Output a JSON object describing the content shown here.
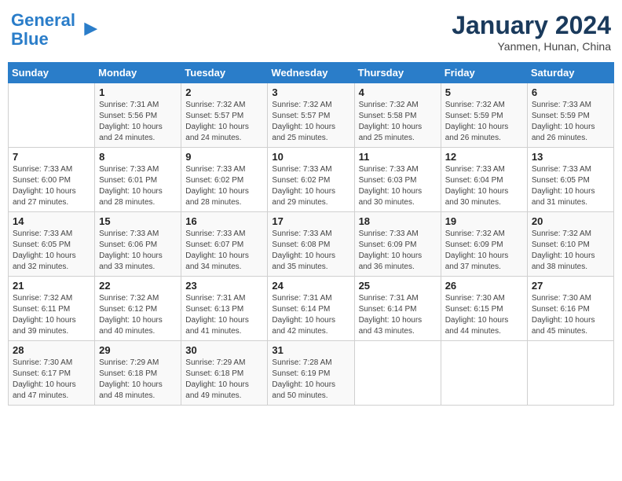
{
  "header": {
    "logo_line1": "General",
    "logo_line2": "Blue",
    "month": "January 2024",
    "location": "Yanmen, Hunan, China"
  },
  "weekdays": [
    "Sunday",
    "Monday",
    "Tuesday",
    "Wednesday",
    "Thursday",
    "Friday",
    "Saturday"
  ],
  "weeks": [
    [
      {
        "day": "",
        "info": ""
      },
      {
        "day": "1",
        "info": "Sunrise: 7:31 AM\nSunset: 5:56 PM\nDaylight: 10 hours\nand 24 minutes."
      },
      {
        "day": "2",
        "info": "Sunrise: 7:32 AM\nSunset: 5:57 PM\nDaylight: 10 hours\nand 24 minutes."
      },
      {
        "day": "3",
        "info": "Sunrise: 7:32 AM\nSunset: 5:57 PM\nDaylight: 10 hours\nand 25 minutes."
      },
      {
        "day": "4",
        "info": "Sunrise: 7:32 AM\nSunset: 5:58 PM\nDaylight: 10 hours\nand 25 minutes."
      },
      {
        "day": "5",
        "info": "Sunrise: 7:32 AM\nSunset: 5:59 PM\nDaylight: 10 hours\nand 26 minutes."
      },
      {
        "day": "6",
        "info": "Sunrise: 7:33 AM\nSunset: 5:59 PM\nDaylight: 10 hours\nand 26 minutes."
      }
    ],
    [
      {
        "day": "7",
        "info": "Sunrise: 7:33 AM\nSunset: 6:00 PM\nDaylight: 10 hours\nand 27 minutes."
      },
      {
        "day": "8",
        "info": "Sunrise: 7:33 AM\nSunset: 6:01 PM\nDaylight: 10 hours\nand 28 minutes."
      },
      {
        "day": "9",
        "info": "Sunrise: 7:33 AM\nSunset: 6:02 PM\nDaylight: 10 hours\nand 28 minutes."
      },
      {
        "day": "10",
        "info": "Sunrise: 7:33 AM\nSunset: 6:02 PM\nDaylight: 10 hours\nand 29 minutes."
      },
      {
        "day": "11",
        "info": "Sunrise: 7:33 AM\nSunset: 6:03 PM\nDaylight: 10 hours\nand 30 minutes."
      },
      {
        "day": "12",
        "info": "Sunrise: 7:33 AM\nSunset: 6:04 PM\nDaylight: 10 hours\nand 30 minutes."
      },
      {
        "day": "13",
        "info": "Sunrise: 7:33 AM\nSunset: 6:05 PM\nDaylight: 10 hours\nand 31 minutes."
      }
    ],
    [
      {
        "day": "14",
        "info": "Sunrise: 7:33 AM\nSunset: 6:05 PM\nDaylight: 10 hours\nand 32 minutes."
      },
      {
        "day": "15",
        "info": "Sunrise: 7:33 AM\nSunset: 6:06 PM\nDaylight: 10 hours\nand 33 minutes."
      },
      {
        "day": "16",
        "info": "Sunrise: 7:33 AM\nSunset: 6:07 PM\nDaylight: 10 hours\nand 34 minutes."
      },
      {
        "day": "17",
        "info": "Sunrise: 7:33 AM\nSunset: 6:08 PM\nDaylight: 10 hours\nand 35 minutes."
      },
      {
        "day": "18",
        "info": "Sunrise: 7:33 AM\nSunset: 6:09 PM\nDaylight: 10 hours\nand 36 minutes."
      },
      {
        "day": "19",
        "info": "Sunrise: 7:32 AM\nSunset: 6:09 PM\nDaylight: 10 hours\nand 37 minutes."
      },
      {
        "day": "20",
        "info": "Sunrise: 7:32 AM\nSunset: 6:10 PM\nDaylight: 10 hours\nand 38 minutes."
      }
    ],
    [
      {
        "day": "21",
        "info": "Sunrise: 7:32 AM\nSunset: 6:11 PM\nDaylight: 10 hours\nand 39 minutes."
      },
      {
        "day": "22",
        "info": "Sunrise: 7:32 AM\nSunset: 6:12 PM\nDaylight: 10 hours\nand 40 minutes."
      },
      {
        "day": "23",
        "info": "Sunrise: 7:31 AM\nSunset: 6:13 PM\nDaylight: 10 hours\nand 41 minutes."
      },
      {
        "day": "24",
        "info": "Sunrise: 7:31 AM\nSunset: 6:14 PM\nDaylight: 10 hours\nand 42 minutes."
      },
      {
        "day": "25",
        "info": "Sunrise: 7:31 AM\nSunset: 6:14 PM\nDaylight: 10 hours\nand 43 minutes."
      },
      {
        "day": "26",
        "info": "Sunrise: 7:30 AM\nSunset: 6:15 PM\nDaylight: 10 hours\nand 44 minutes."
      },
      {
        "day": "27",
        "info": "Sunrise: 7:30 AM\nSunset: 6:16 PM\nDaylight: 10 hours\nand 45 minutes."
      }
    ],
    [
      {
        "day": "28",
        "info": "Sunrise: 7:30 AM\nSunset: 6:17 PM\nDaylight: 10 hours\nand 47 minutes."
      },
      {
        "day": "29",
        "info": "Sunrise: 7:29 AM\nSunset: 6:18 PM\nDaylight: 10 hours\nand 48 minutes."
      },
      {
        "day": "30",
        "info": "Sunrise: 7:29 AM\nSunset: 6:18 PM\nDaylight: 10 hours\nand 49 minutes."
      },
      {
        "day": "31",
        "info": "Sunrise: 7:28 AM\nSunset: 6:19 PM\nDaylight: 10 hours\nand 50 minutes."
      },
      {
        "day": "",
        "info": ""
      },
      {
        "day": "",
        "info": ""
      },
      {
        "day": "",
        "info": ""
      }
    ]
  ]
}
